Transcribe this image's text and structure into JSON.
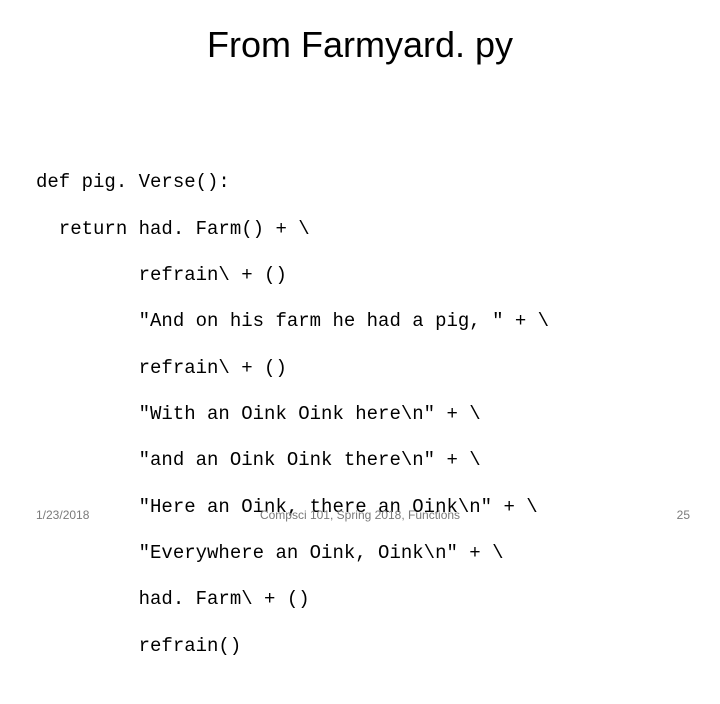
{
  "title": "From Farmyard. py",
  "code": {
    "l0": "def pig. Verse():",
    "l1": "  return had. Farm() + \\",
    "l2": "         refrain\\ + ()",
    "l3": "         \"And on his farm he had a pig, \" + \\",
    "l4": "         refrain\\ + ()",
    "l5": "         \"With an Oink Oink here\\n\" + \\",
    "l6": "         \"and an Oink Oink there\\n\" + \\",
    "l7": "         \"Here an Oink, there an Oink\\n\" + \\",
    "l8": "         \"Everywhere an Oink, Oink\\n\" + \\",
    "l9": "         had. Farm\\ + ()",
    "l10": "         refrain()"
  },
  "footer": {
    "date": "1/23/2018",
    "center": "Compsci 101, Spring 2018, Functions",
    "page": "25"
  }
}
